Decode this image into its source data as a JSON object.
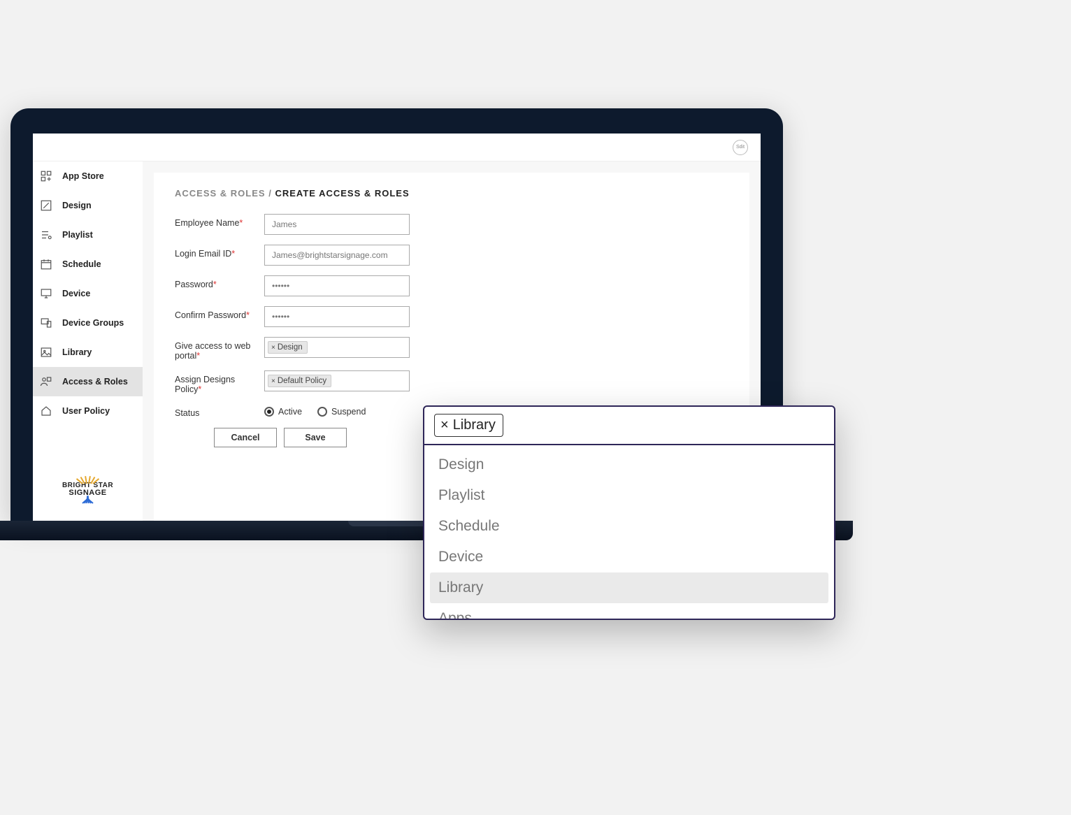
{
  "logo": {
    "line1": "BRIGHT STAR",
    "line2": "SIGNAGE"
  },
  "sidebar": {
    "items": [
      {
        "label": "App Store"
      },
      {
        "label": "Design"
      },
      {
        "label": "Playlist"
      },
      {
        "label": "Schedule"
      },
      {
        "label": "Device"
      },
      {
        "label": "Device Groups"
      },
      {
        "label": "Library"
      },
      {
        "label": "Access & Roles",
        "active": true
      },
      {
        "label": "User Policy"
      }
    ]
  },
  "breadcrumb": {
    "parent": "ACCESS & ROLES",
    "sep": "/",
    "current": "CREATE ACCESS & ROLES"
  },
  "form": {
    "employee_name": {
      "label": "Employee Name",
      "value": "James"
    },
    "login_email": {
      "label": "Login Email ID",
      "value": "James@brightstarsignage.com"
    },
    "password": {
      "label": "Password",
      "value": "••••••"
    },
    "confirm_password": {
      "label": "Confirm Password",
      "value": "••••••"
    },
    "web_portal_access": {
      "label": "Give access to web portal",
      "tags": [
        "Design"
      ]
    },
    "assign_policy": {
      "label": "Assign Designs Policy",
      "tags": [
        "Default Policy"
      ]
    },
    "status": {
      "label": "Status",
      "options": [
        "Active",
        "Suspend"
      ],
      "selected": "Active"
    }
  },
  "buttons": {
    "cancel": "Cancel",
    "save": "Save"
  },
  "avatar_label": "Sdit",
  "dropdown": {
    "selected_tag": "Library",
    "options": [
      "Design",
      "Playlist",
      "Schedule",
      "Device",
      "Library",
      "Apps"
    ],
    "highlighted": "Library"
  }
}
